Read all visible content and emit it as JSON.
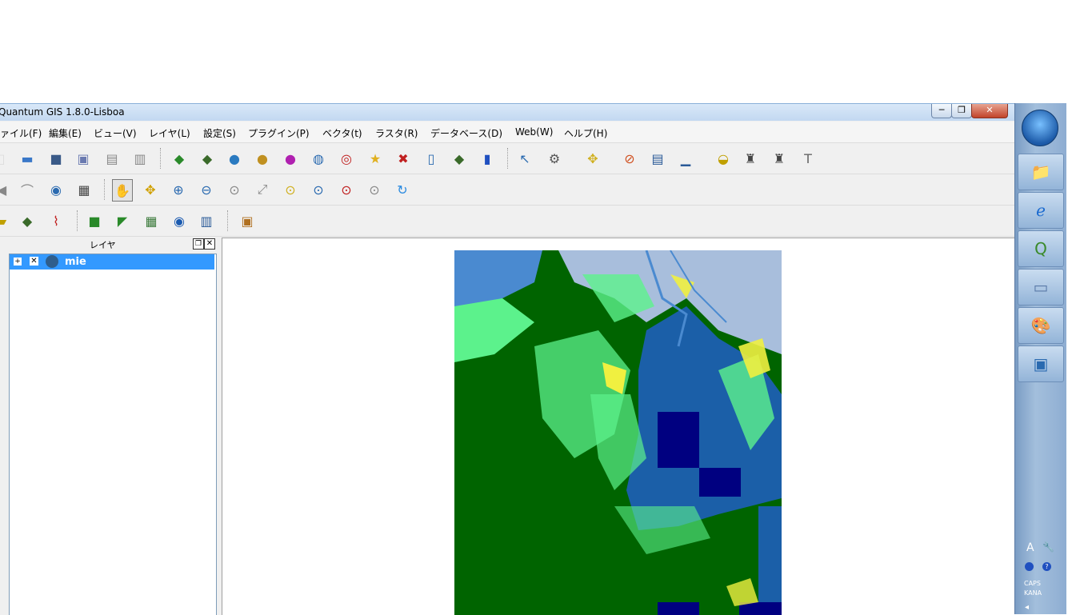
{
  "window": {
    "title": "Quantum GIS 1.8.0-Lisboa",
    "minimize_glyph": "─",
    "maximize_glyph": "❐",
    "close_glyph": "✕"
  },
  "menu": [
    "ファイル(F)",
    "編集(E)",
    "ビュー(V)",
    "レイヤ(L)",
    "設定(S)",
    "プラグイン(P)",
    "ベクタ(t)",
    "ラスタ(R)",
    "データベース(D)",
    "Web(W)",
    "ヘルプ(H)"
  ],
  "toolbars": {
    "file": [
      "new-project-icon",
      "open-project-icon",
      "save-project-icon",
      "save-as-icon",
      "print-composer-icon",
      "composer-manager-icon"
    ],
    "layer": [
      "add-vector-layer-icon",
      "add-raster-layer-icon",
      "add-postgis-layer-icon",
      "add-spatialite-layer-icon",
      "add-mssql-layer-icon",
      "add-wms-layer-icon",
      "add-wfs-layer-icon",
      "new-shapefile-icon",
      "remove-layer-icon",
      "new-spatialite-icon",
      "add-delimited-text-icon",
      "add-oracle-icon"
    ],
    "attributes": [
      "identify-icon",
      "run-action-icon",
      "select-icon",
      "deselect-icon",
      "attribute-table-icon",
      "measure-icon",
      "map-tips-icon",
      "new-bookmark-icon",
      "show-bookmarks-icon",
      "text-annotation-icon"
    ],
    "navigation": [
      "pan-icon",
      "pan-to-selection-icon",
      "zoom-in-icon",
      "zoom-out-icon",
      "zoom-actual-size-icon",
      "zoom-full-icon",
      "zoom-to-selection-icon",
      "zoom-to-layer-icon",
      "zoom-last-icon",
      "zoom-next-icon",
      "refresh-icon"
    ],
    "plugins": [
      "georeferencer-icon",
      "openlayers-icon",
      "heatmap-icon",
      "raster-calculator-icon",
      "gdal-tools-icon",
      "db-manager-icon"
    ],
    "extra": [
      "screenshot-icon"
    ]
  },
  "layers_panel": {
    "title": "レイヤ",
    "layers": [
      {
        "name": "mie",
        "expanded": false,
        "visible": true,
        "selected": true
      }
    ]
  },
  "map": {
    "layer": "mie",
    "colors": {
      "water": "#1b5fa8",
      "deep_water": "#000080",
      "forest": "#006400",
      "grass": "#5cf28c",
      "urban": "#a8bedc",
      "crop": "#f0f040"
    }
  },
  "taskbar": {
    "apps": [
      "explorer-icon",
      "internet-explorer-icon",
      "qgis-icon",
      "notepad-icon",
      "paint-icon",
      "photo-viewer-icon"
    ],
    "tray_lines": [
      "CAPS",
      "KANA"
    ]
  }
}
